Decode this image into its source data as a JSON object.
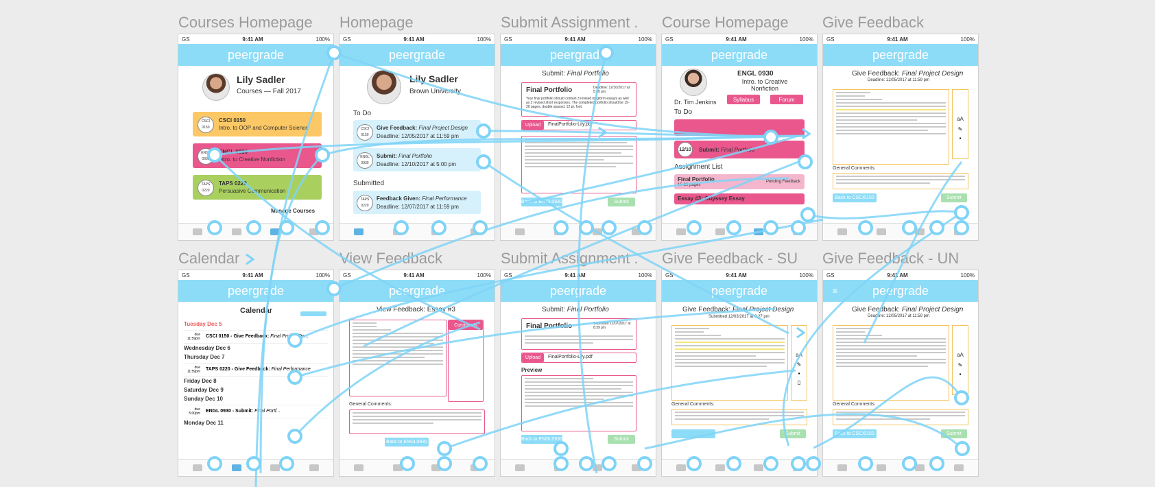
{
  "screens": [
    {
      "title": "Courses Homepage"
    },
    {
      "title": "Homepage"
    },
    {
      "title": "Submit Assignment ..."
    },
    {
      "title": "Course Homepage"
    },
    {
      "title": "Give Feedback"
    },
    {
      "title": "Calendar"
    },
    {
      "title": "View Feedback"
    },
    {
      "title": "Submit Assignment ..."
    },
    {
      "title": "Give Feedback - SUB..."
    },
    {
      "title": "Give Feedback - UN..."
    }
  ],
  "common": {
    "app_name": "peergrade",
    "time": "9:41 AM",
    "carrier": "GS",
    "battery": "100%"
  },
  "courses_homepage": {
    "user_name": "Lily Sadler",
    "subtitle": "Courses — Fall 2017",
    "courses": [
      {
        "code": "CSCI 0150",
        "name": "Intro. to OOP and Computer Science",
        "color": "#fcc865"
      },
      {
        "code": "ENGL 0930",
        "name": "Intro. to Creative Nonfiction",
        "color": "#e9578c"
      },
      {
        "code": "TAPS 0220",
        "name": "Persuasive Communication",
        "color": "#a9d05f"
      }
    ],
    "manage": "Manage Courses"
  },
  "homepage": {
    "user_name": "Lily Sadler",
    "school": "Brown University",
    "todo_label": "To Do",
    "todo": [
      {
        "code": "CSCI 0150",
        "action": "Give Feedback:",
        "item": "Final Project Design",
        "deadline": "Deadline: 12/05/2017 at 11:59 pm"
      },
      {
        "code": "ENGL 0930",
        "action": "Submit:",
        "item": "Final Portfolio",
        "deadline": "Deadline: 12/10/2017 at 5:00 pm"
      }
    ],
    "submitted_label": "Submitted",
    "submitted": [
      {
        "code": "TAPS 0220",
        "action": "Feedback Given:",
        "item": "Final Performance",
        "deadline": "Deadline: 12/07/2017 at 11:59 pm"
      }
    ]
  },
  "submit_assignment": {
    "heading_prefix": "Submit:",
    "heading_item": "Final Portfolio",
    "box_title": "Final Portfolio",
    "deadline": "Deadline: 12/10/2017 at 5:00 pm",
    "description": "Your final portfolio should contain 3 revised longform essays as well as 2 revised short responses. The completed portfolio should be 15-20 pages, double spaced, 12 pt. font.",
    "upload_label": "Upload",
    "file": "FinalPortfolio-Lily.pdf",
    "back_label": "Back to ENGL0930",
    "submit_label": "Submit"
  },
  "course_homepage": {
    "code": "ENGL 0930",
    "name": "Intro. to Creative Nonfiction",
    "professor": "Dr. Tim Jenkins",
    "syllabus": "Syllabus",
    "forum": "Forum",
    "todo_label": "To Do",
    "todo_item_date": "12/10",
    "todo_item_action": "Submit:",
    "todo_item": "Final Portfolio",
    "assign_list_label": "Assignment List",
    "assign_1": "Final Portfolio",
    "assign_1_pages": "15-20 pages",
    "assign_1_status": "Pending Feedback",
    "assign_2": "Essay #3: Odyssey Essay"
  },
  "give_feedback": {
    "heading_prefix": "Give Feedback:",
    "heading_item": "Final Project Design",
    "deadline": "Deadline: 12/05/2017 at 11:59 pm",
    "general_comments": "General Comments:",
    "back_label": "Back to CSCI0150",
    "submit_label": "Submit",
    "submitted": "Submitted 12/03/2017 at 3:27 pm"
  },
  "calendar": {
    "title": "Calendar",
    "days": [
      {
        "label": "Tuesday Dec 5",
        "highlight": true,
        "events": [
          {
            "due": "due 11:59pm",
            "text": "CSCI 0150 - Give Feedback: ",
            "item": "Final Project De..."
          }
        ]
      },
      {
        "label": "Wednesday Dec 6",
        "events": []
      },
      {
        "label": "Thursday Dec 7",
        "events": [
          {
            "due": "due 11:59pm",
            "text": "TAPS 0220 - Give Feedback: ",
            "item": "Final Performance"
          }
        ]
      },
      {
        "label": "Friday Dec 8",
        "events": []
      },
      {
        "label": "Saturday Dec 9",
        "events": []
      },
      {
        "label": "Sunday Dec 10",
        "events": [
          {
            "due": "due 5:00pm",
            "text": "ENGL 0930 - Submit: ",
            "item": "Final Portf..."
          }
        ]
      },
      {
        "label": "Monday Dec 11",
        "events": []
      }
    ]
  },
  "view_feedback": {
    "heading": "View Feedback: Essay #3",
    "comments_label": "Comments",
    "general_comments": "General Comments:",
    "back_label": "Back to ENGL0930"
  },
  "submit_assignment_2": {
    "heading_prefix": "Submit:",
    "heading_item": "Final Portfolio",
    "box_title": "Final Portfolio",
    "submitted": "Submitted 12/07/2017 at 8:39 pm",
    "upload_label": "Upload",
    "file": "FinalPortfolio-Lily.pdf",
    "preview_label": "Preview",
    "back_label": "Back to ENGL0930",
    "submit_label": "Submit"
  },
  "colors": {
    "accent": "#8ddcf7",
    "link": "#4fc3f7",
    "pink": "#e9578c",
    "yellow": "#fcc865",
    "green": "#a9d05f",
    "title": "#9b9b9b"
  }
}
